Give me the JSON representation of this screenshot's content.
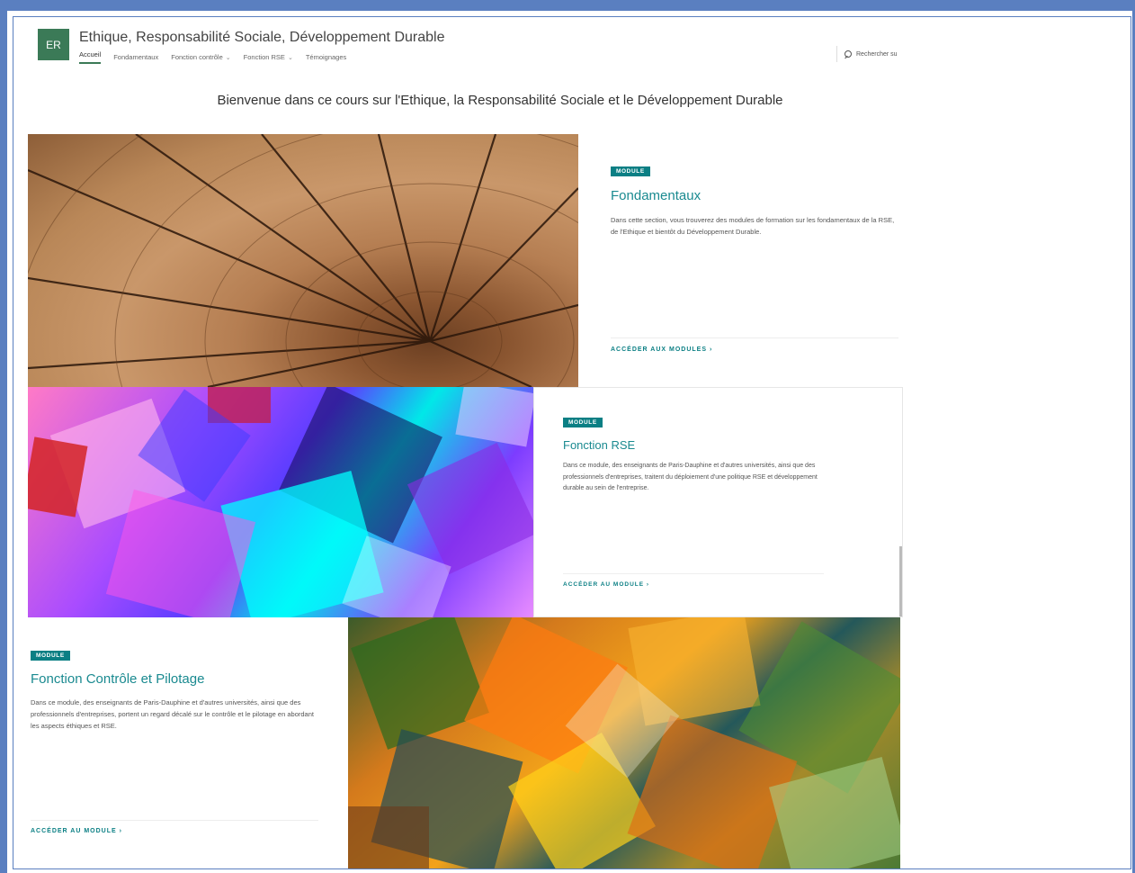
{
  "site": {
    "logo_initials": "ER",
    "title": "Ethique, Responsabilité Sociale, Développement Durable",
    "nav": [
      {
        "label": "Accueil",
        "active": true,
        "has_dropdown": false
      },
      {
        "label": "Fondamentaux",
        "active": false,
        "has_dropdown": false
      },
      {
        "label": "Fonction contrôle",
        "active": false,
        "has_dropdown": true
      },
      {
        "label": "Fonction RSE",
        "active": false,
        "has_dropdown": true
      },
      {
        "label": "Témoignages",
        "active": false,
        "has_dropdown": false
      }
    ],
    "search_placeholder": "Rechercher su",
    "accent_color": "#3b7a57"
  },
  "main": {
    "welcome": "Bienvenue dans ce cours sur l'Ethique, la Responsabilité Sociale et le Développement Durable",
    "modules": [
      {
        "badge": "MODULE",
        "title": "Fondamentaux",
        "description": "Dans cette section, vous trouverez des modules de formation sur les fondamentaux de la RSE, de l'Ethique et bientôt du Développement Durable.",
        "link": "ACCÉDER AUX MODULES",
        "image": "wood-rings"
      },
      {
        "badge": "MODULE",
        "title": "Fonction RSE",
        "description": "Dans ce module, des enseignants de Paris-Dauphine et d'autres universités, ainsi que des professionnels d'entreprises, traitent du déploiement d'une politique RSE et développement durable au sein de l'entreprise.",
        "link": "ACCÉDER AU MODULE",
        "image": "purple-cyan-squares"
      },
      {
        "badge": "MODULE",
        "title": "Fonction Contrôle et Pilotage",
        "description": "Dans ce module, des enseignants de Paris-Dauphine et d'autres universités, ainsi que des professionnels d'entreprises, portent un regard décalé sur le contrôle et le pilotage en abordant les aspects éthiques et RSE.",
        "link": "ACCÉDER AU MODULE",
        "image": "orange-green-squares"
      }
    ],
    "badge_color": "#0b7f84",
    "link_color": "#0b7f84"
  }
}
